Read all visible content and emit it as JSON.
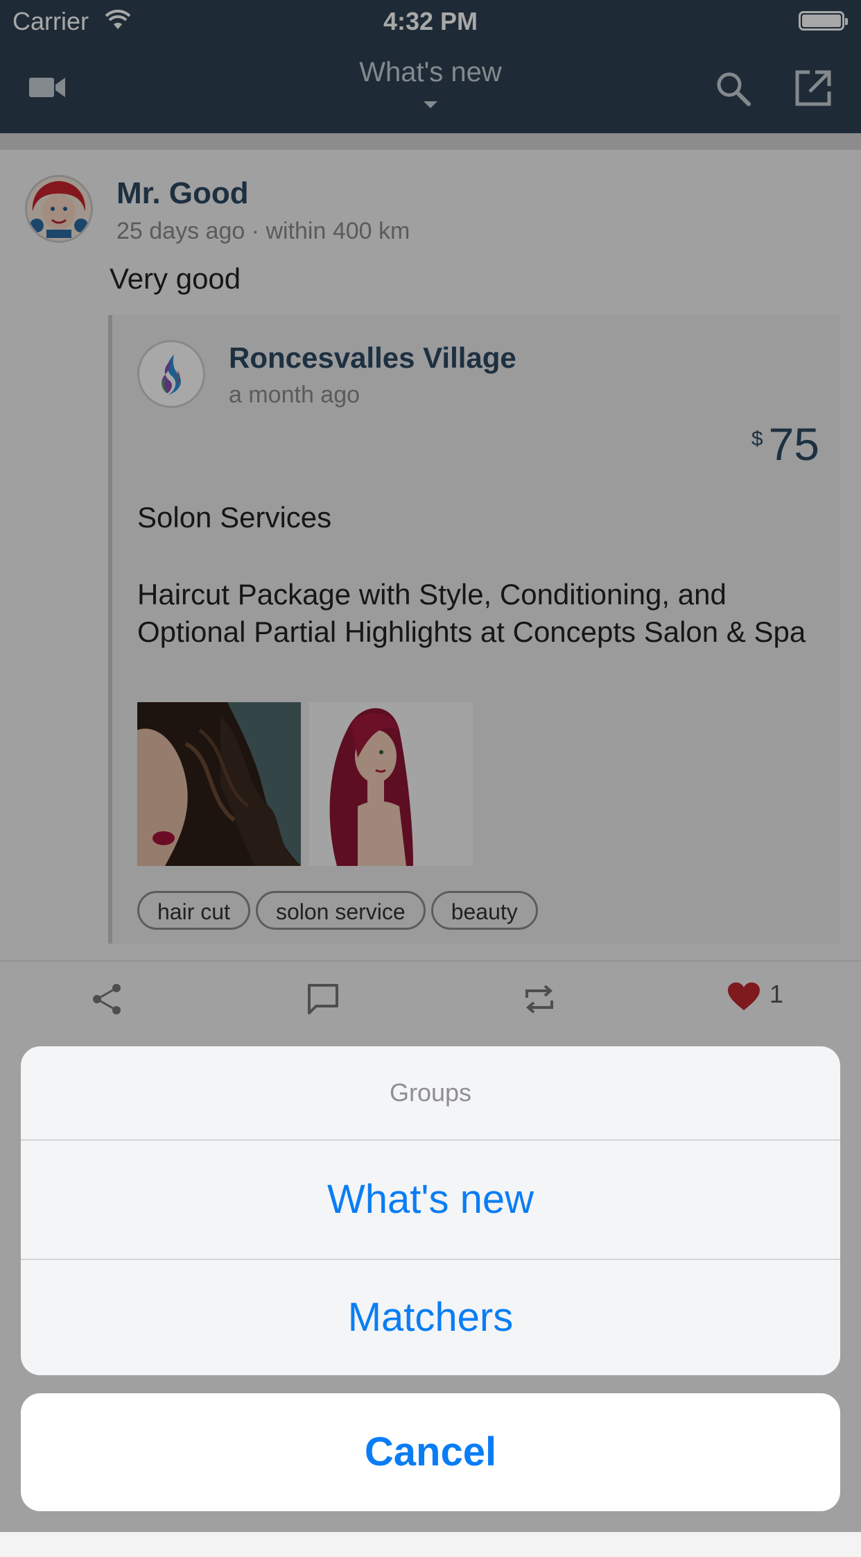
{
  "status_bar": {
    "carrier": "Carrier",
    "time": "4:32 PM"
  },
  "nav": {
    "title": "What's new"
  },
  "post": {
    "author": "Mr. Good",
    "meta": "25 days ago · within 400 km",
    "text": "Very good",
    "shared": {
      "business_name": "Roncesvalles Village",
      "time": "a month ago",
      "price_currency": "$",
      "price_amount": "75",
      "service_title": "Solon Services",
      "description": "Haircut Package with Style, Conditioning, and Optional Partial Highlights at Concepts Salon & Spa",
      "tags": [
        "hair cut",
        "solon service",
        "beauty"
      ]
    },
    "like_count": "1"
  },
  "action_sheet": {
    "title": "Groups",
    "options": [
      "What's new",
      "Matchers"
    ],
    "cancel": "Cancel"
  },
  "colors": {
    "nav_bg": "#2e4252",
    "accent_blue": "#0a7df5",
    "author_blue": "#2c4a63",
    "heart_red": "#c0262d"
  },
  "icons": [
    "video-camera-icon",
    "search-icon",
    "compose-icon",
    "share-icon",
    "comment-icon",
    "repost-icon",
    "heart-icon"
  ]
}
